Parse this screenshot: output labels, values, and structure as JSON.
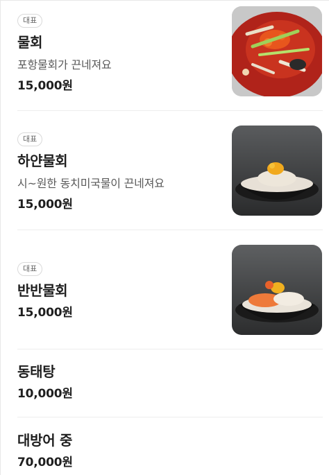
{
  "menu": {
    "items": [
      {
        "badge": "대표",
        "name": "물회",
        "description": "포항물회가 끈네져요",
        "price": "15,000원",
        "image": "spicy-cold-raw-fish-soup-photo"
      },
      {
        "badge": "대표",
        "name": "하얀물회",
        "description": "시~원한 동치미국물이 끈네져요",
        "price": "15,000원",
        "image": "white-cold-raw-fish-soup-photo"
      },
      {
        "badge": "대표",
        "name": "반반물회",
        "price": "15,000원",
        "image": "half-and-half-cold-raw-fish-soup-photo"
      },
      {
        "name": "동태탕",
        "price": "10,000원"
      },
      {
        "name": "대방어 중",
        "price": "70,000원"
      }
    ]
  },
  "colors": {
    "border": "#ededed",
    "text_primary": "#1f1f1f",
    "text_secondary": "#5a5a5a",
    "badge_border": "#d9d9d9"
  }
}
